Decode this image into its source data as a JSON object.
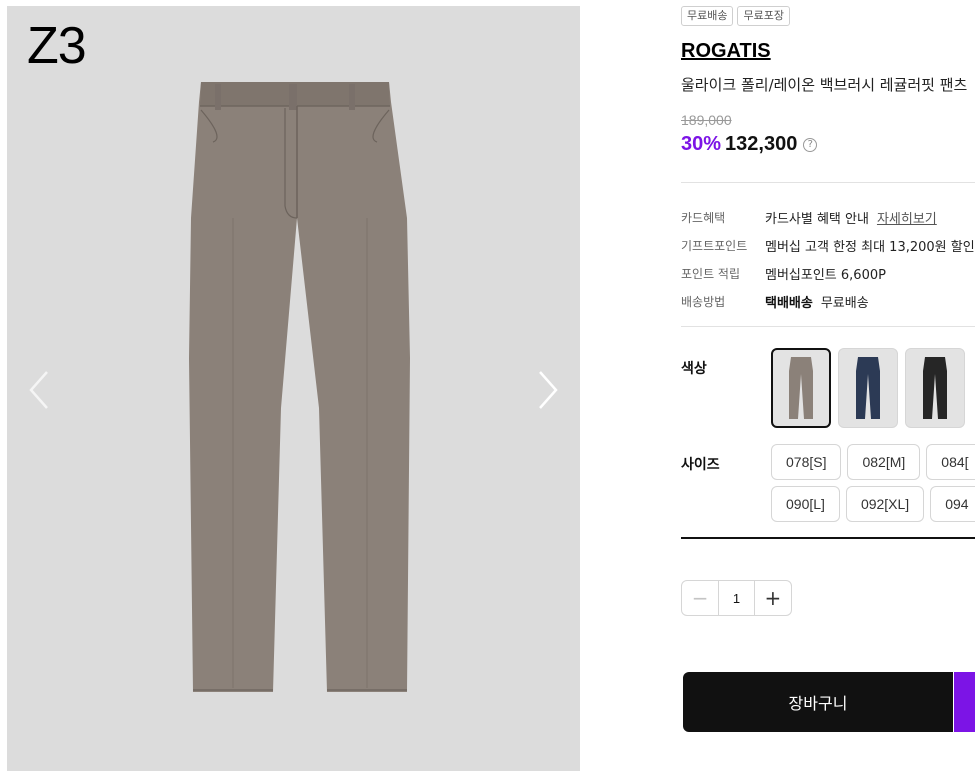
{
  "gallery": {
    "brand_mark": "Z3",
    "prev_icon": "chevron-left-icon",
    "next_icon": "chevron-right-icon"
  },
  "product": {
    "badges": [
      "무료배송",
      "무료포장"
    ],
    "brand": "ROGATIS",
    "name": "울라이크 폴리/레이온 백브러시 레귤러핏 팬츠",
    "original_price": "189,000",
    "discount": "30%",
    "price": "132,300",
    "help_icon": "question-circle-icon",
    "help_glyph": "?"
  },
  "benefits": [
    {
      "label": "카드혜택",
      "value": "카드사별 혜택 안내",
      "link": "자세히보기"
    },
    {
      "label": "기프트포인트",
      "value": "멤버십 고객 한정 최대 13,200원 할인("
    },
    {
      "label": "포인트 적립",
      "value": "멤버십포인트 6,600P"
    },
    {
      "label": "배송방법",
      "bold": "택배배송",
      "value": "무료배송"
    }
  ],
  "options": {
    "color_label": "색상",
    "size_label": "사이즈",
    "colors": [
      {
        "hex": "#8b8179"
      },
      {
        "hex": "#2c3a55"
      },
      {
        "hex": "#262626"
      }
    ],
    "sizes": [
      "078[S]",
      "082[M]",
      "084[",
      "090[L]",
      "092[XL]",
      "094"
    ]
  },
  "quantity": {
    "minus": "−",
    "value": "1",
    "plus": "+"
  },
  "actions": {
    "cart_label": "장바구니"
  },
  "colors": {
    "accent": "#7c14e6",
    "gallery_bg": "#dcdcdc",
    "pants_main": "#8b8179"
  }
}
